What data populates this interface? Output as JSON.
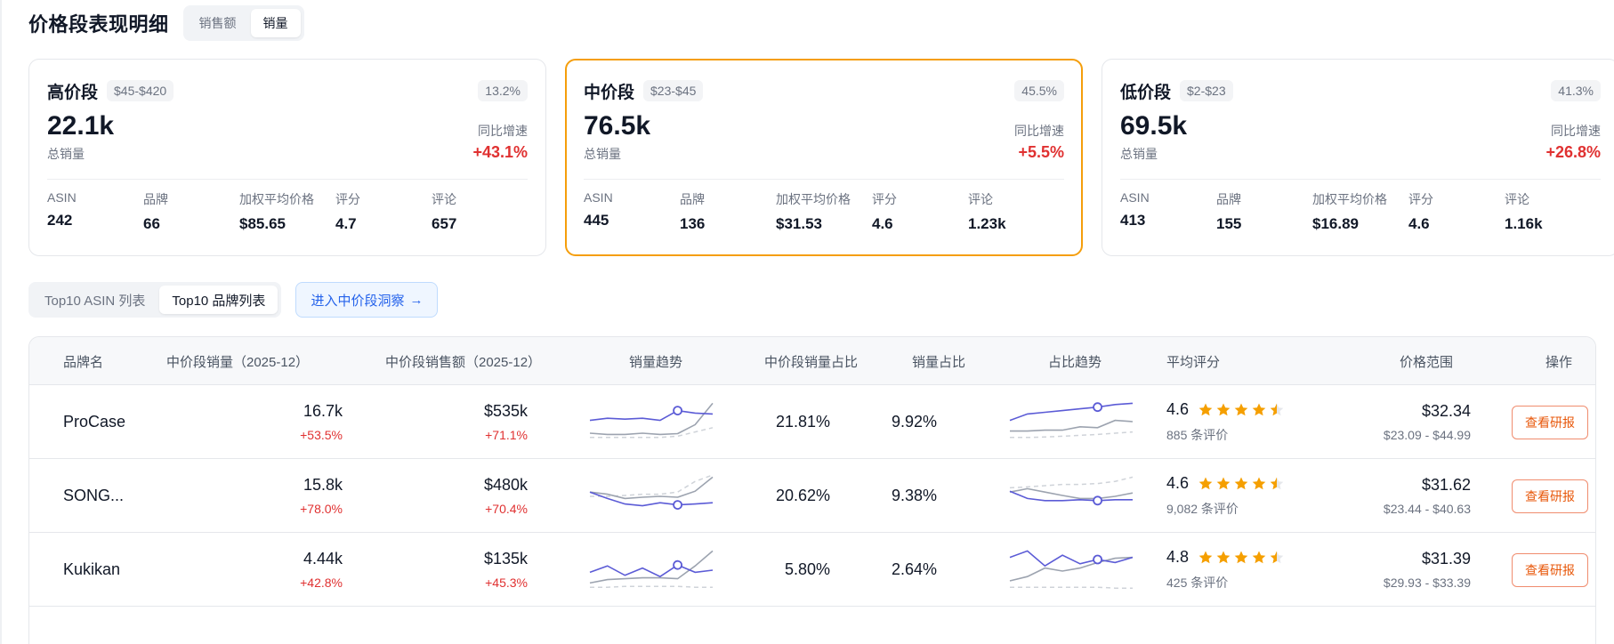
{
  "header": {
    "title": "价格段表现明细",
    "toggle": [
      {
        "label": "销售额",
        "active": false
      },
      {
        "label": "销量",
        "active": true
      }
    ]
  },
  "cards": [
    {
      "name": "高价段",
      "range": "$45-$420",
      "share": "13.2%",
      "value": "22.1k",
      "value_label": "总销量",
      "growth_label": "同比增速",
      "growth": "+43.1%",
      "selected": false,
      "stats": [
        {
          "label": "ASIN",
          "value": "242"
        },
        {
          "label": "品牌",
          "value": "66"
        },
        {
          "label": "加权平均价格",
          "value": "$85.65"
        },
        {
          "label": "评分",
          "value": "4.7"
        },
        {
          "label": "评论",
          "value": "657"
        }
      ]
    },
    {
      "name": "中价段",
      "range": "$23-$45",
      "share": "45.5%",
      "value": "76.5k",
      "value_label": "总销量",
      "growth_label": "同比增速",
      "growth": "+5.5%",
      "selected": true,
      "stats": [
        {
          "label": "ASIN",
          "value": "445"
        },
        {
          "label": "品牌",
          "value": "136"
        },
        {
          "label": "加权平均价格",
          "value": "$31.53"
        },
        {
          "label": "评分",
          "value": "4.6"
        },
        {
          "label": "评论",
          "value": "1.23k"
        }
      ]
    },
    {
      "name": "低价段",
      "range": "$2-$23",
      "share": "41.3%",
      "value": "69.5k",
      "value_label": "总销量",
      "growth_label": "同比增速",
      "growth": "+26.8%",
      "selected": false,
      "stats": [
        {
          "label": "ASIN",
          "value": "413"
        },
        {
          "label": "品牌",
          "value": "155"
        },
        {
          "label": "加权平均价格",
          "value": "$16.89"
        },
        {
          "label": "评分",
          "value": "4.6"
        },
        {
          "label": "评论",
          "value": "1.16k"
        }
      ]
    }
  ],
  "tabs": [
    {
      "label": "Top10 ASIN 列表",
      "active": false
    },
    {
      "label": "Top10 品牌列表",
      "active": true
    }
  ],
  "insight_button": "进入中价段洞察",
  "table": {
    "columns": [
      "品牌名",
      "中价段销量（2025-12）",
      "中价段销售额（2025-12）",
      "销量趋势",
      "中价段销量占比",
      "销量占比",
      "占比趋势",
      "平均评分",
      "价格范围",
      "操作"
    ],
    "rows": [
      {
        "brand": "ProCase",
        "units": "16.7k",
        "units_growth": "+53.5%",
        "sales": "$535k",
        "sales_growth": "+71.1%",
        "mid_share": "21.81%",
        "share": "9.92%",
        "rating": "4.6",
        "stars": 4.5,
        "reviews": "885 条评价",
        "price": "$32.34",
        "price_range": "$23.09 - $44.99",
        "action": "查看研报",
        "units_trend": [
          0.55,
          0.6,
          0.58,
          0.6,
          0.55,
          0.78,
          0.72,
          0.7
        ],
        "units_trend_ref": [
          0.25,
          0.22,
          0.22,
          0.25,
          0.22,
          0.24,
          0.45,
          0.95
        ],
        "units_trend_avg": [
          0.15,
          0.15,
          0.15,
          0.15,
          0.15,
          0.18,
          0.28,
          0.38
        ],
        "share_trend": [
          0.55,
          0.7,
          0.74,
          0.78,
          0.82,
          0.86,
          0.92,
          0.95
        ],
        "share_trend_ref": [
          0.3,
          0.3,
          0.32,
          0.32,
          0.4,
          0.38,
          0.55,
          0.52
        ],
        "share_trend_avg": [
          0.15,
          0.15,
          0.16,
          0.18,
          0.2,
          0.22,
          0.25,
          0.28
        ]
      },
      {
        "brand": "SONG...",
        "units": "15.8k",
        "units_growth": "+78.0%",
        "sales": "$480k",
        "sales_growth": "+70.4%",
        "mid_share": "20.62%",
        "share": "9.38%",
        "rating": "4.6",
        "stars": 4.5,
        "reviews": "9,082 条评价",
        "price": "$31.62",
        "price_range": "$23.44 - $40.63",
        "action": "查看研报",
        "units_trend": [
          0.6,
          0.45,
          0.32,
          0.28,
          0.35,
          0.3,
          0.32,
          0.35
        ],
        "units_trend_ref": [
          0.6,
          0.55,
          0.45,
          0.48,
          0.5,
          0.48,
          0.62,
          0.95
        ],
        "units_trend_avg": [
          0.5,
          0.5,
          0.52,
          0.55,
          0.55,
          0.6,
          0.85,
          1.0
        ],
        "share_trend": [
          0.62,
          0.45,
          0.4,
          0.4,
          0.42,
          0.4,
          0.42,
          0.42
        ],
        "share_trend_ref": [
          0.6,
          0.68,
          0.6,
          0.52,
          0.45,
          0.45,
          0.5,
          0.58
        ],
        "share_trend_avg": [
          0.7,
          0.72,
          0.75,
          0.78,
          0.78,
          0.8,
          0.85,
          0.95
        ]
      },
      {
        "brand": "Kukikan",
        "units": "4.44k",
        "units_growth": "+42.8%",
        "sales": "$135k",
        "sales_growth": "+45.3%",
        "mid_share": "5.80%",
        "share": "2.64%",
        "rating": "4.8",
        "stars": 4.5,
        "reviews": "425 条评价",
        "price": "$31.39",
        "price_range": "$29.93 - $33.39",
        "action": "查看研报",
        "units_trend": [
          0.45,
          0.6,
          0.38,
          0.55,
          0.35,
          0.62,
          0.45,
          0.5
        ],
        "units_trend_ref": [
          0.2,
          0.28,
          0.3,
          0.32,
          0.32,
          0.3,
          0.6,
          0.95
        ],
        "units_trend_avg": [
          0.1,
          0.1,
          0.12,
          0.12,
          0.12,
          0.12,
          0.1,
          0.1
        ],
        "share_trend": [
          0.8,
          0.95,
          0.6,
          0.85,
          0.65,
          0.75,
          0.68,
          0.8
        ],
        "share_trend_ref": [
          0.25,
          0.35,
          0.55,
          0.48,
          0.55,
          0.68,
          0.78,
          0.8
        ],
        "share_trend_avg": [
          0.1,
          0.1,
          0.1,
          0.1,
          0.1,
          0.1,
          0.08,
          0.08
        ]
      }
    ]
  },
  "colors": {
    "accent_orange": "#f59e0b",
    "growth_red": "#e03131",
    "link_blue": "#2563eb",
    "spark_blue": "#5b5bd6",
    "spark_gray": "#9ca3af",
    "star_gold": "#f59f00"
  }
}
